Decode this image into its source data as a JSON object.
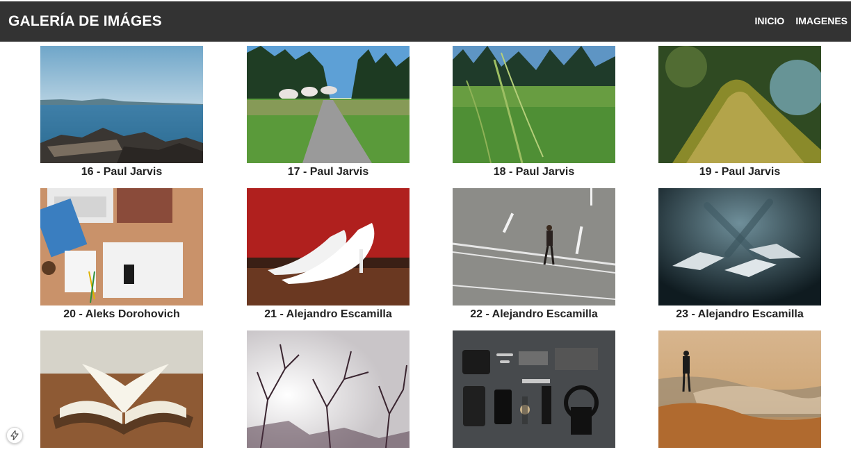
{
  "header": {
    "title": "GALERÍA DE IMÁGES",
    "nav": [
      {
        "label": "INICIO"
      },
      {
        "label": "IMAGENES"
      }
    ]
  },
  "gallery": {
    "items": [
      {
        "caption": "16 - Paul Jarvis"
      },
      {
        "caption": "17 - Paul Jarvis"
      },
      {
        "caption": "18 - Paul Jarvis"
      },
      {
        "caption": "19 - Paul Jarvis"
      },
      {
        "caption": "20 - Aleks Dorohovich"
      },
      {
        "caption": "21 - Alejandro Escamilla"
      },
      {
        "caption": "22 - Alejandro Escamilla"
      },
      {
        "caption": "23 - Alejandro Escamilla"
      },
      {
        "caption": ""
      },
      {
        "caption": ""
      },
      {
        "caption": ""
      },
      {
        "caption": ""
      }
    ]
  },
  "widget": {
    "icon": "bolt-icon"
  },
  "colors": {
    "navbar": "#333333",
    "nav_text": "#ffffff",
    "caption": "#222222"
  }
}
